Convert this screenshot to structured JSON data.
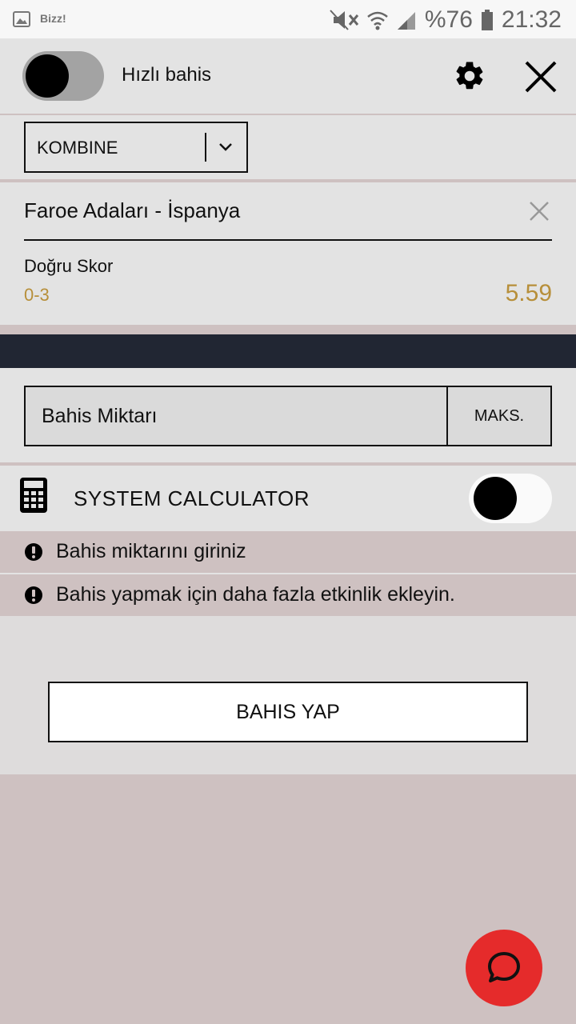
{
  "status_bar": {
    "app_name": "Bizz!",
    "battery": "%76",
    "time": "21:32",
    "icons": [
      "gallery-icon",
      "mute-icon",
      "wifi-icon",
      "signal-icon",
      "battery-icon"
    ]
  },
  "header": {
    "quick_bet_label": "Hızlı bahis",
    "quick_bet_on": false,
    "icons": [
      "settings-gear-icon",
      "close-icon"
    ]
  },
  "bet_type": {
    "selected": "KOMBINE"
  },
  "selection": {
    "match": "Faroe Adaları - İspanya",
    "market": "Doğru Skor",
    "pick": "0-3",
    "odds": "5.59"
  },
  "stake": {
    "label": "Bahis Miktarı",
    "max_label": "MAKS."
  },
  "system_calculator": {
    "label": "SYSTEM CALCULATOR",
    "enabled": false
  },
  "warnings": [
    {
      "text": "Bahis miktarını giriniz"
    },
    {
      "text": "Bahis yapmak için daha fazla etkinlik ekleyin."
    }
  ],
  "actions": {
    "place_bet_label": "BAHIS YAP"
  },
  "colors": {
    "accent_red": "#e52b2b",
    "odds_gold": "#b78f3a",
    "dark_bar": "#212633",
    "page_bg": "#cec1c1"
  }
}
